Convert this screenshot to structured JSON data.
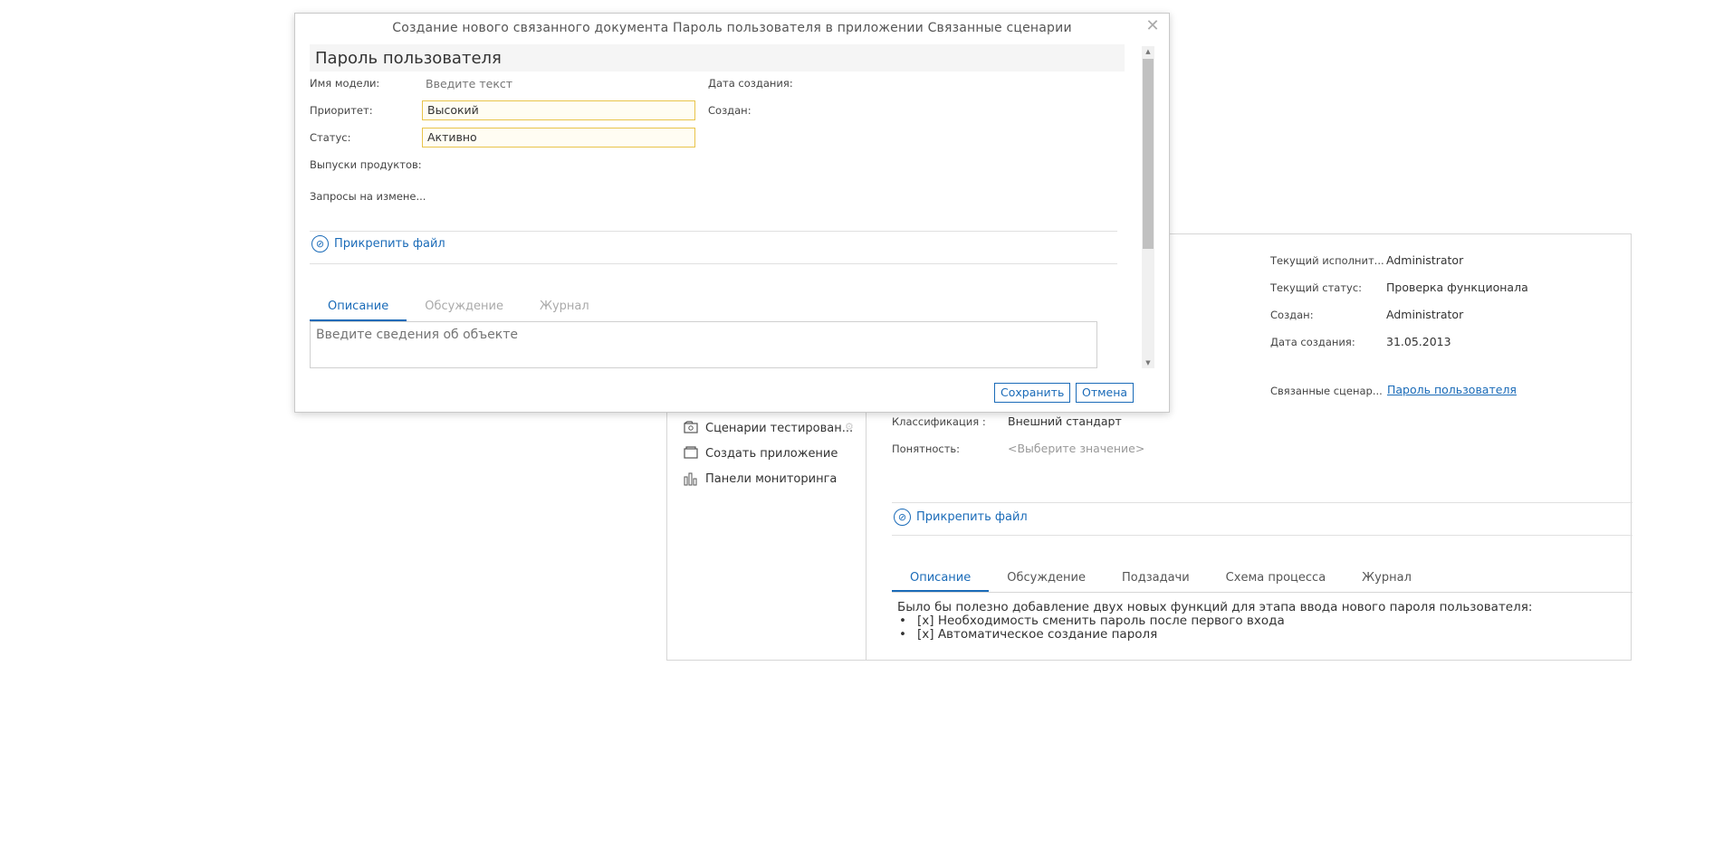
{
  "background": {
    "nav": [
      {
        "label": "Сценарии тестирован...",
        "icon": "test-scenarios-icon"
      },
      {
        "label": "Создать приложение",
        "icon": "create-app-icon"
      },
      {
        "label": "Панели мониторинга",
        "icon": "dashboard-chart-icon"
      }
    ],
    "meta": {
      "executor_label": "Текущий исполнит...",
      "executor_value": "Administrator",
      "status_label": "Текущий статус:",
      "status_value": "Проверка функционала",
      "created_by_label": "Создан:",
      "created_by_value": "Administrator",
      "created_date_label": "Дата создания:",
      "created_date_value": "31.05.2013",
      "linked_label": "Связанные сценар...",
      "linked_value": "Пароль пользователя",
      "classification_label": "Классификация :",
      "classification_value": "Внешний стандарт",
      "clarity_label": "Понятность:",
      "clarity_value": "<Выберите значение>"
    },
    "attach_label": "Прикрепить файл",
    "tabs": [
      "Описание",
      "Обсуждение",
      "Подзадачи",
      "Схема процесса",
      "Журнал"
    ],
    "description": {
      "intro": "Было бы полезно добавление двух новых функций для этапа ввода нового пароля пользователя:",
      "items": [
        "[x] Необходимость сменить пароль после первого входа",
        "[x] Автоматическое создание пароля"
      ]
    }
  },
  "dialog": {
    "title": "Создание нового связанного документа Пароль пользователя в приложении Связанные сценарии",
    "name": "Пароль пользователя",
    "fields": {
      "model_label": "Имя модели:",
      "model_placeholder": "Введите текст",
      "priority_label": "Приоритет:",
      "priority_value": "Высокий",
      "status_label": "Статус:",
      "status_value": "Активно",
      "releases_label": "Выпуски продуктов:",
      "requests_label": "Запросы на измене...",
      "created_date_label": "Дата создания:",
      "created_by_label": "Создан:"
    },
    "attach_label": "Прикрепить файл",
    "tabs": [
      "Описание",
      "Обсуждение",
      "Журнал"
    ],
    "description_placeholder": "Введите сведения об объекте",
    "save_label": "Сохранить",
    "cancel_label": "Отмена"
  }
}
